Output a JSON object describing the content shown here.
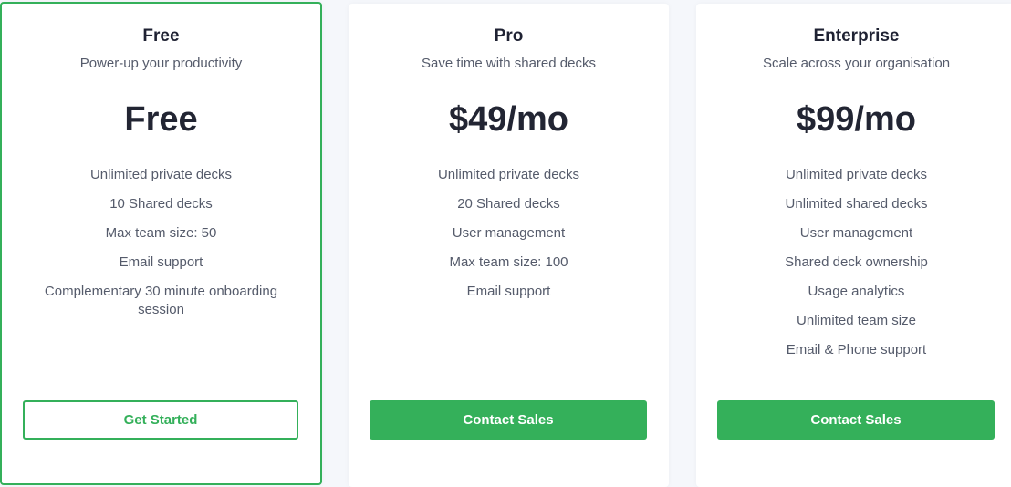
{
  "colors": {
    "accent": "#34b05a",
    "text_dark": "#222533",
    "text_muted": "#555b6b",
    "background": "#f5f7fb"
  },
  "plans": [
    {
      "name": "Free",
      "tagline": "Power-up your productivity",
      "price": "Free",
      "featured": true,
      "features": [
        "Unlimited private decks",
        "10 Shared decks",
        "Max team size: 50",
        "Email support",
        "Complementary 30 minute onboarding session"
      ],
      "cta": "Get Started"
    },
    {
      "name": "Pro",
      "tagline": "Save time with shared decks",
      "price": "$49/mo",
      "featured": false,
      "features": [
        "Unlimited private decks",
        "20 Shared decks",
        "User management",
        "Max team size: 100",
        "Email support"
      ],
      "cta": "Contact Sales"
    },
    {
      "name": "Enterprise",
      "tagline": "Scale across your organisation",
      "price": "$99/mo",
      "featured": false,
      "features": [
        "Unlimited private decks",
        "Unlimited shared decks",
        "User management",
        "Shared deck ownership",
        "Usage analytics",
        "Unlimited team size",
        "Email & Phone support"
      ],
      "cta": "Contact Sales"
    }
  ]
}
